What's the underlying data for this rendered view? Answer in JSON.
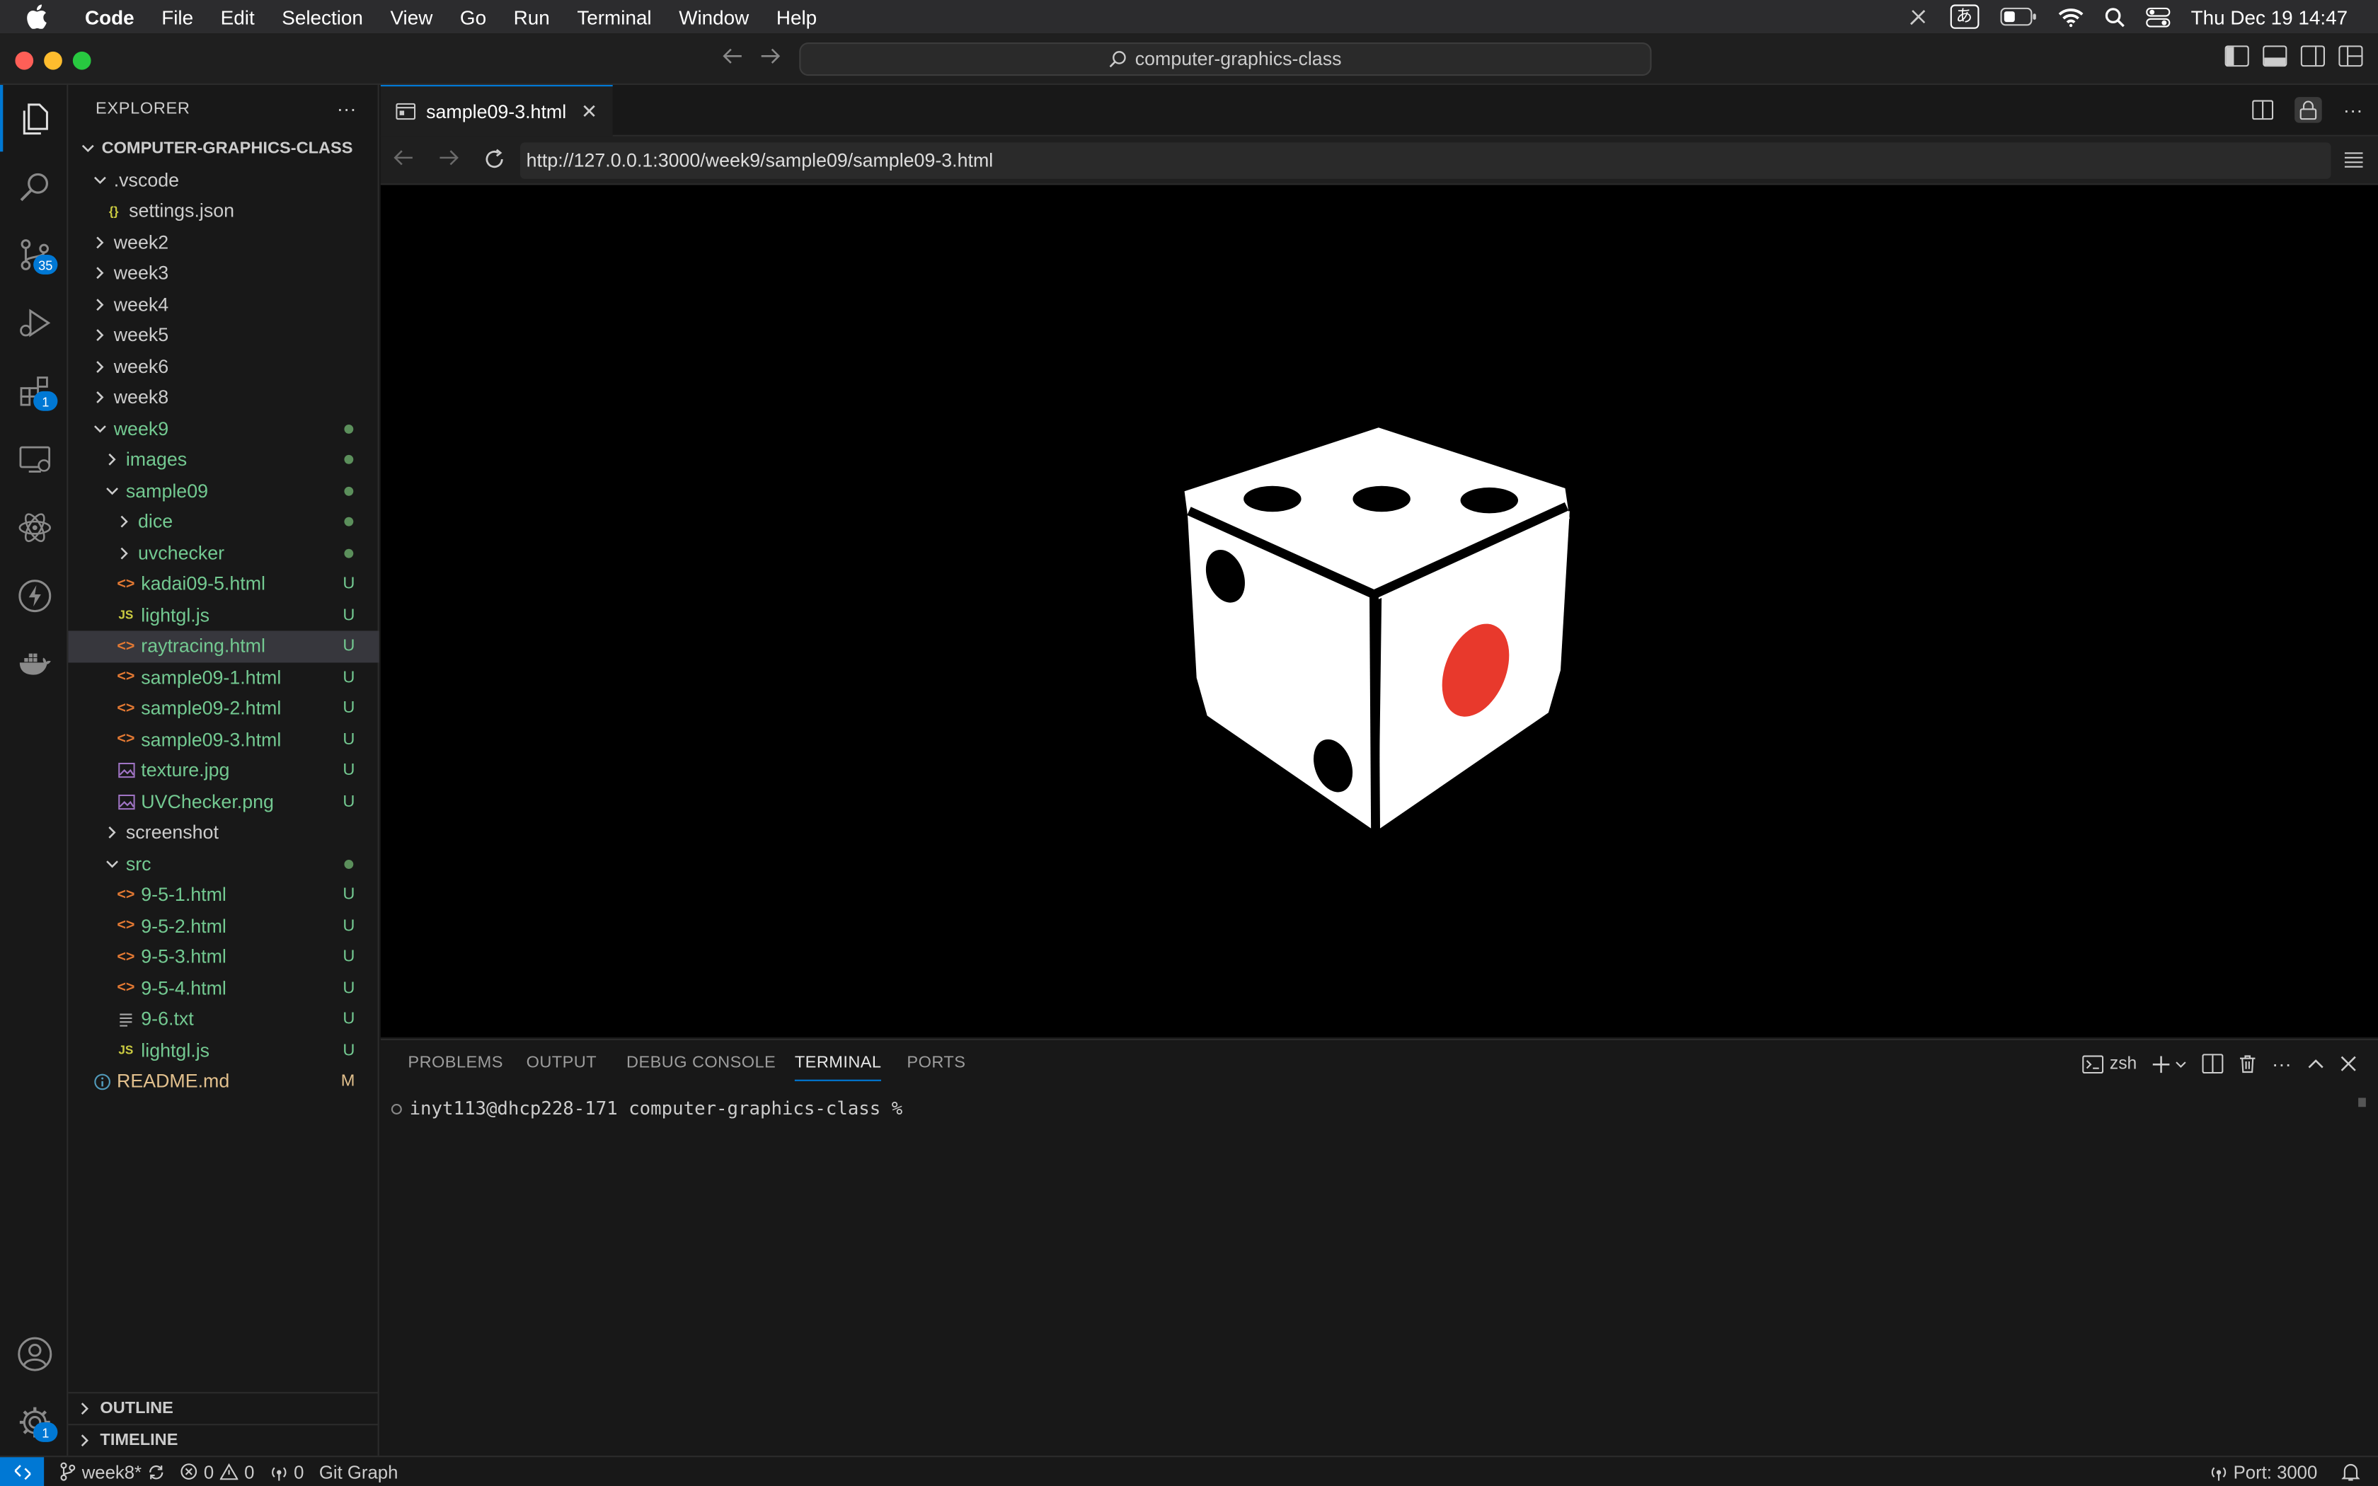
{
  "menubar": {
    "app_name": "Code",
    "items": [
      "File",
      "Edit",
      "Selection",
      "View",
      "Go",
      "Run",
      "Terminal",
      "Window",
      "Help"
    ],
    "input_method": "あ",
    "clock": "Thu Dec 19  14:47"
  },
  "titlebar": {
    "search_text": "computer-graphics-class"
  },
  "activitybar": {
    "source_control_badge": "35",
    "extensions_badge": "1",
    "settings_badge": "1"
  },
  "explorer": {
    "title": "EXPLORER",
    "root": "COMPUTER-GRAPHICS-CLASS",
    "items": [
      {
        "label": ".vscode",
        "kind": "folder-open",
        "indent": 1,
        "status": "",
        "color": "white"
      },
      {
        "label": "settings.json",
        "kind": "json",
        "indent": 2,
        "status": "",
        "color": "white"
      },
      {
        "label": "week2",
        "kind": "folder",
        "indent": 1,
        "status": "",
        "color": "white"
      },
      {
        "label": "week3",
        "kind": "folder",
        "indent": 1,
        "status": "",
        "color": "white"
      },
      {
        "label": "week4",
        "kind": "folder",
        "indent": 1,
        "status": "",
        "color": "white"
      },
      {
        "label": "week5",
        "kind": "folder",
        "indent": 1,
        "status": "",
        "color": "white"
      },
      {
        "label": "week6",
        "kind": "folder",
        "indent": 1,
        "status": "",
        "color": "white"
      },
      {
        "label": "week8",
        "kind": "folder",
        "indent": 1,
        "status": "",
        "color": "white"
      },
      {
        "label": "week9",
        "kind": "folder-open",
        "indent": 1,
        "status": "dot",
        "color": "green"
      },
      {
        "label": "images",
        "kind": "folder",
        "indent": 2,
        "status": "dot",
        "color": "green"
      },
      {
        "label": "sample09",
        "kind": "folder-open",
        "indent": 2,
        "status": "dot",
        "color": "green"
      },
      {
        "label": "dice",
        "kind": "folder",
        "indent": 3,
        "status": "dot",
        "color": "green"
      },
      {
        "label": "uvchecker",
        "kind": "folder",
        "indent": 3,
        "status": "dot",
        "color": "green"
      },
      {
        "label": "kadai09-5.html",
        "kind": "html",
        "indent": 3,
        "status": "U",
        "color": "green"
      },
      {
        "label": "lightgl.js",
        "kind": "js",
        "indent": 3,
        "status": "U",
        "color": "green"
      },
      {
        "label": "raytracing.html",
        "kind": "html",
        "indent": 3,
        "status": "U",
        "color": "green",
        "selected": true
      },
      {
        "label": "sample09-1.html",
        "kind": "html",
        "indent": 3,
        "status": "U",
        "color": "green"
      },
      {
        "label": "sample09-2.html",
        "kind": "html",
        "indent": 3,
        "status": "U",
        "color": "green"
      },
      {
        "label": "sample09-3.html",
        "kind": "html",
        "indent": 3,
        "status": "U",
        "color": "green"
      },
      {
        "label": "texture.jpg",
        "kind": "img",
        "indent": 3,
        "status": "U",
        "color": "green"
      },
      {
        "label": "UVChecker.png",
        "kind": "img",
        "indent": 3,
        "status": "U",
        "color": "green"
      },
      {
        "label": "screenshot",
        "kind": "folder",
        "indent": 2,
        "status": "",
        "color": "white"
      },
      {
        "label": "src",
        "kind": "folder-open",
        "indent": 2,
        "status": "dot",
        "color": "green"
      },
      {
        "label": "9-5-1.html",
        "kind": "html",
        "indent": 3,
        "status": "U",
        "color": "green"
      },
      {
        "label": "9-5-2.html",
        "kind": "html",
        "indent": 3,
        "status": "U",
        "color": "green"
      },
      {
        "label": "9-5-3.html",
        "kind": "html",
        "indent": 3,
        "status": "U",
        "color": "green"
      },
      {
        "label": "9-5-4.html",
        "kind": "html",
        "indent": 3,
        "status": "U",
        "color": "green"
      },
      {
        "label": "9-6.txt",
        "kind": "txt",
        "indent": 3,
        "status": "U",
        "color": "green"
      },
      {
        "label": "lightgl.js",
        "kind": "js",
        "indent": 3,
        "status": "U",
        "color": "green"
      },
      {
        "label": "README.md",
        "kind": "info",
        "indent": 1,
        "status": "M",
        "color": "modified"
      }
    ],
    "outline_label": "OUTLINE",
    "timeline_label": "TIMELINE"
  },
  "editor": {
    "tab_label": "sample09-3.html",
    "url": "http://127.0.0.1:3000/week9/sample09/sample09-3.html"
  },
  "panel": {
    "tabs": [
      "PROBLEMS",
      "OUTPUT",
      "DEBUG CONSOLE",
      "TERMINAL",
      "PORTS"
    ],
    "active_tab": "TERMINAL",
    "shell_label": "zsh",
    "prompt": "inyt113@dhcp228-171 computer-graphics-class %"
  },
  "statusbar": {
    "branch": "week8*",
    "errors": "0",
    "warnings": "0",
    "ports": "0",
    "git_graph": "Git Graph",
    "port_label": "Port: 3000"
  },
  "colors": {
    "accent": "#0078d4",
    "untracked_green": "#73c991",
    "modified_yellow": "#e2c08d",
    "pip_red": "#e8392c"
  }
}
